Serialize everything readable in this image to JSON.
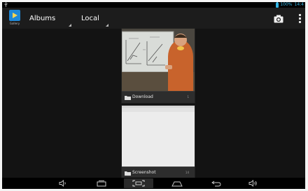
{
  "status_bar": {
    "battery": "100%",
    "time": "14:4",
    "accent_color": "#33b5e5"
  },
  "action_bar": {
    "app_icon_label": "Gallery",
    "view_spinner": "Albums",
    "source_spinner": "Local",
    "camera_icon": "camera-icon",
    "overflow_icon": "overflow-menu-icon"
  },
  "albums": [
    {
      "name": "Download",
      "count": "1",
      "thumbnail": "whiteboard-photo"
    },
    {
      "name": "Screenshot",
      "count": "14",
      "thumbnail": "screenshot"
    }
  ],
  "nav_bar": {
    "buttons": [
      "volume-down-icon",
      "recent-apps-icon",
      "screenshot-icon",
      "home-icon",
      "back-icon",
      "volume-up-icon"
    ]
  }
}
